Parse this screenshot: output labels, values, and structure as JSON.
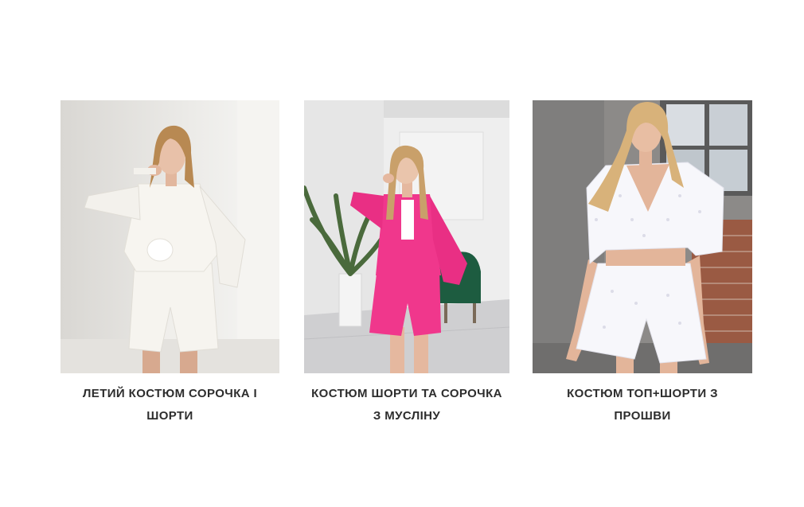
{
  "products": [
    {
      "title": "ЛЕТИЙ КОСТЮМ СОРОЧКА І\nШОРТИ",
      "image": "woman-white-shirt-and-shorts-set"
    },
    {
      "title": "КОСТЮМ ШОРТИ ТА СОРОЧКА\nЗ МУСЛІНУ",
      "image": "woman-pink-muslin-shirt-and-shorts-set"
    },
    {
      "title": "КОСТЮМ ТОП+ШОРТИ З\nПРОШВИ",
      "image": "woman-white-eyelet-top-and-shorts-set"
    }
  ],
  "colors": {
    "caption_text": "#2d2d2d",
    "outfit_white": "#f4f2ee",
    "outfit_pink": "#f0378c",
    "outfit_eyelet": "#f7f7fb"
  }
}
